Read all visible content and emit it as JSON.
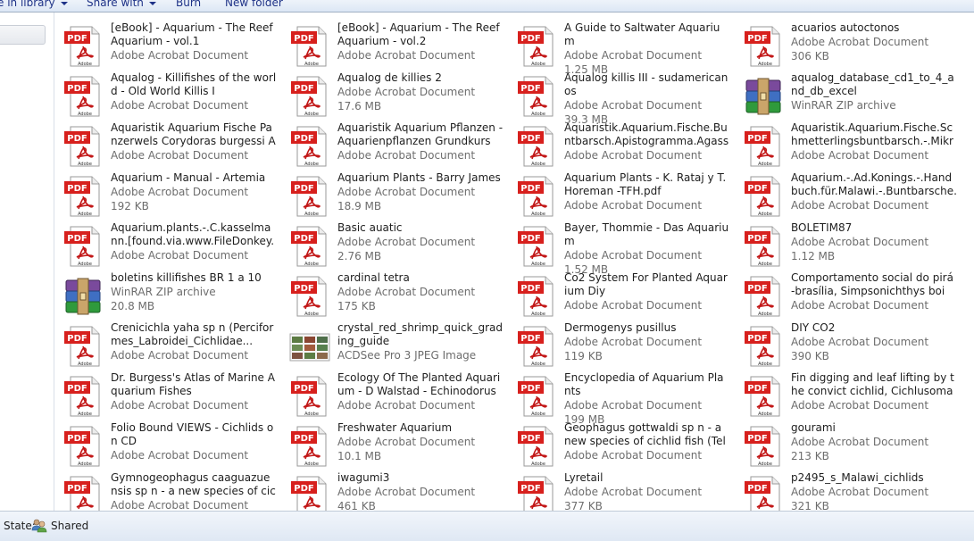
{
  "toolbar": {
    "include_label": "e in library",
    "share_label": "Share with",
    "burn_label": "Burn",
    "new_folder_label": "New folder"
  },
  "icons": {
    "pdf": "pdf-file-icon",
    "rar": "winrar-archive-icon",
    "jpg": "jpeg-thumbnail-icon",
    "shared": "shared-users-icon"
  },
  "colors": {
    "pdf_red": "#d7201d",
    "status_bg": "#e5edf7"
  },
  "files": [
    {
      "name": "[eBook] - Aquarium - The Reef Aquarium - vol.1",
      "type": "Adobe Acrobat Document",
      "size": "",
      "icon": "pdf"
    },
    {
      "name": "[eBook] - Aquarium - The Reef Aquarium - vol.2",
      "type": "Adobe Acrobat Document",
      "size": "",
      "icon": "pdf"
    },
    {
      "name": "A Guide to Saltwater Aquarium",
      "type": "Adobe Acrobat Document",
      "size": "1.25 MB",
      "icon": "pdf"
    },
    {
      "name": "acuarios autoctonos",
      "type": "Adobe Acrobat Document",
      "size": "306 KB",
      "icon": "pdf"
    },
    {
      "name": "Aqualog - Killifishes of the world - Old World Killis I",
      "type": "Adobe Acrobat Document",
      "size": "",
      "icon": "pdf"
    },
    {
      "name": "Aqualog de killies 2",
      "type": "Adobe Acrobat Document",
      "size": "17.6 MB",
      "icon": "pdf"
    },
    {
      "name": "Aqualog killis III - sudamericanos",
      "type": "Adobe Acrobat Document",
      "size": "39.3 MB",
      "icon": "pdf"
    },
    {
      "name": "aqualog_database_cd1_to_4_and_db_excel",
      "type": "WinRAR ZIP archive",
      "size": "",
      "icon": "rar"
    },
    {
      "name": "Aquaristik Aquarium Fische Panzerwels Corydoras burgessi Ax...",
      "type": "Adobe Acrobat Document",
      "size": "",
      "icon": "pdf"
    },
    {
      "name": "Aquaristik Aquarium Pflanzen - Aquarienpflanzen Grundkurs",
      "type": "Adobe Acrobat Document",
      "size": "",
      "icon": "pdf"
    },
    {
      "name": "Aquaristik.Aquarium.Fische.Buntbarsch.Apistogramma.Agassizii.[fou...",
      "type": "Adobe Acrobat Document",
      "size": "",
      "icon": "pdf"
    },
    {
      "name": "Aquaristik.Aquarium.Fische.Schmetterlingsbuntbarsch.-.Mikrogeop...",
      "type": "Adobe Acrobat Document",
      "size": "",
      "icon": "pdf"
    },
    {
      "name": "Aquarium - Manual - Artemia",
      "type": "Adobe Acrobat Document",
      "size": "192 KB",
      "icon": "pdf"
    },
    {
      "name": "Aquarium Plants - Barry James",
      "type": "Adobe Acrobat Document",
      "size": "18.9 MB",
      "icon": "pdf"
    },
    {
      "name": "Aquarium Plants - K. Rataj y T. Horeman -TFH.pdf",
      "type": "Adobe Acrobat Document",
      "size": "",
      "icon": "pdf"
    },
    {
      "name": "Aquarium.-.Ad.Konings.-.Handbuch.für.Malawi.-.Buntbarsche.(Cichl...",
      "type": "Adobe Acrobat Document",
      "size": "",
      "icon": "pdf"
    },
    {
      "name": "Aquarium.plants.-.C.kasselmann.[found.via.www.FileDonkey.com]",
      "type": "Adobe Acrobat Document",
      "size": "",
      "icon": "pdf"
    },
    {
      "name": "Basic auatic",
      "type": "Adobe Acrobat Document",
      "size": "2.76 MB",
      "icon": "pdf"
    },
    {
      "name": "Bayer, Thommie - Das Aquarium",
      "type": "Adobe Acrobat Document",
      "size": "1.52 MB",
      "icon": "pdf"
    },
    {
      "name": "BOLETIM87",
      "type": "Adobe Acrobat Document",
      "size": "1.12 MB",
      "icon": "pdf"
    },
    {
      "name": "boletins killifishes BR 1 a 10",
      "type": "WinRAR ZIP archive",
      "size": "20.8 MB",
      "icon": "rar"
    },
    {
      "name": "cardinal tetra",
      "type": "Adobe Acrobat Document",
      "size": "175 KB",
      "icon": "pdf"
    },
    {
      "name": "Co2 System For Planted Aquarium Diy",
      "type": "Adobe Acrobat Document",
      "size": "",
      "icon": "pdf"
    },
    {
      "name": "Comportamento social do pirá-brasília, Simpsonichthys boit...",
      "type": "Adobe Acrobat Document",
      "size": "",
      "icon": "pdf"
    },
    {
      "name": "Crenicichla yaha sp n (Perciformes_Labroidei_Cichlidae...",
      "type": "Adobe Acrobat Document",
      "size": "",
      "icon": "pdf"
    },
    {
      "name": "crystal_red_shrimp_quick_grading_guide",
      "type": "ACDSee Pro 3 JPEG Image",
      "size": "",
      "icon": "jpg"
    },
    {
      "name": "Dermogenys pusillus",
      "type": "Adobe Acrobat Document",
      "size": "119 KB",
      "icon": "pdf"
    },
    {
      "name": "DIY CO2",
      "type": "Adobe Acrobat Document",
      "size": "390 KB",
      "icon": "pdf"
    },
    {
      "name": "Dr. Burgess's Atlas of Marine Aquarium Fishes",
      "type": "Adobe Acrobat Document",
      "size": "",
      "icon": "pdf"
    },
    {
      "name": "Ecology Of The Planted Aquarium - D Walstad - Echinodorus Press",
      "type": "Adobe Acrobat Document",
      "size": "",
      "icon": "pdf"
    },
    {
      "name": "Encyclopedia of Aquarium Plants",
      "type": "Adobe Acrobat Document",
      "size": "199 MB",
      "icon": "pdf"
    },
    {
      "name": "Fin digging and leaf lifting by the convict cichlid, Cichlusoma nigro...",
      "type": "Adobe Acrobat Document",
      "size": "",
      "icon": "pdf"
    },
    {
      "name": "Folio Bound VIEWS - Cichlids on CD",
      "type": "Adobe Acrobat Document",
      "size": "",
      "icon": "pdf"
    },
    {
      "name": "Freshwater Aquarium",
      "type": "Adobe Acrobat Document",
      "size": "10.1 MB",
      "icon": "pdf"
    },
    {
      "name": "Geophagus gottwaldi sp n - a new species of cichlid fish (Teleostei P...",
      "type": "Adobe Acrobat Document",
      "size": "",
      "icon": "pdf"
    },
    {
      "name": "gourami",
      "type": "Adobe Acrobat Document",
      "size": "213 KB",
      "icon": "pdf"
    },
    {
      "name": "Gymnogeophagus caaguazuensis sp n - a new species of cichlid fis...",
      "type": "Adobe Acrobat Document",
      "size": "",
      "icon": "pdf"
    },
    {
      "name": "iwagumi3",
      "type": "Adobe Acrobat Document",
      "size": "461 KB",
      "icon": "pdf"
    },
    {
      "name": "Lyretail",
      "type": "Adobe Acrobat Document",
      "size": "377 KB",
      "icon": "pdf"
    },
    {
      "name": "p2495_s_Malawi_cichlids",
      "type": "Adobe Acrobat Document",
      "size": "321 KB",
      "icon": "pdf"
    }
  ],
  "status": {
    "label": "State:",
    "value": "Shared"
  }
}
